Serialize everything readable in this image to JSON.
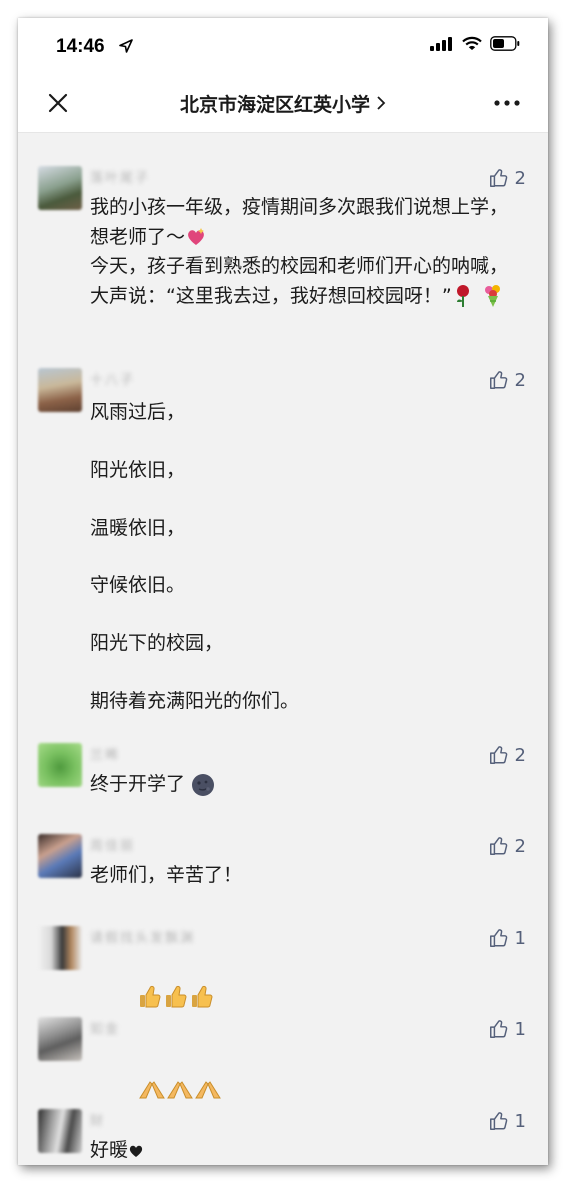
{
  "status": {
    "time": "14:46"
  },
  "nav": {
    "title": "北京市海淀区红英小学"
  },
  "comments": [
    {
      "name": "落叶尾子",
      "likes": "2",
      "text_1": "我的小孩一年级，疫情期间多次跟我们说想上学，想老师了～",
      "text_2": "今天，孩子看到熟悉的校园和老师们开心的呐喊，大声说：“这里我去过，我好想回校园呀！”"
    },
    {
      "name": "十八子",
      "likes": "2",
      "lines": [
        "风雨过后，",
        "阳光依旧，",
        "温暖依旧，",
        "守候依旧。",
        "阳光下的校园，",
        "期待着充满阳光的你们。"
      ]
    },
    {
      "name": "兰晞",
      "likes": "2",
      "text": "终于开学了"
    },
    {
      "name": "周佳丽",
      "likes": "2",
      "text": "老师们，辛苦了！"
    },
    {
      "name": "请假找头发飘渊",
      "likes": "1",
      "text": ""
    },
    {
      "name": "如金",
      "likes": "1",
      "text": ""
    },
    {
      "name": "财",
      "likes": "1",
      "text": "好暖"
    }
  ],
  "icons": [
    "location-arrow-icon",
    "signal-icon",
    "wifi-icon",
    "battery-icon",
    "close-icon",
    "chevron-right-icon",
    "more-icon",
    "thumbs-up-icon"
  ]
}
